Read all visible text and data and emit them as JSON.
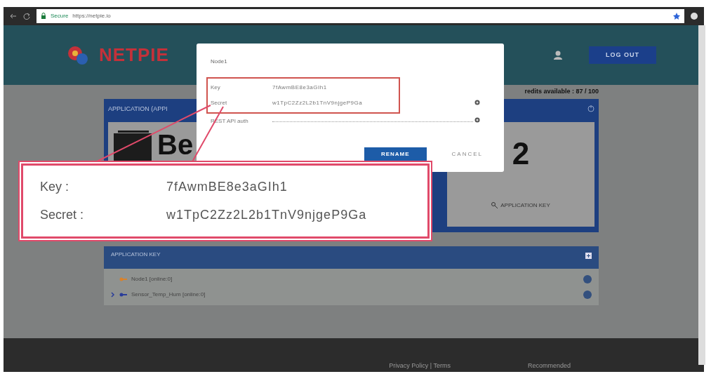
{
  "browser": {
    "secure_label": "Secure",
    "url": "https://netpie.io"
  },
  "header": {
    "logo": "NETPIE",
    "logout": "LOG OUT"
  },
  "credits": "redits available : 87 / 100",
  "app_card": {
    "title": "APPLICATION (APPI",
    "name": "Be",
    "count": "2",
    "key_button": "APPLICATION KEY"
  },
  "key_panel": {
    "title": "APPLICATION KEY",
    "rows": [
      {
        "label": "Node1 [online:0]",
        "kind": "leaf",
        "color": "#d9822b"
      },
      {
        "label": "Sensor_Temp_Hum [online:0]",
        "kind": "group",
        "color": "#2a3d9a"
      }
    ]
  },
  "dialog": {
    "title": "Node1",
    "fields": [
      {
        "label": "Key",
        "value": "7fAwmBE8e3aGIh1",
        "kind": "text",
        "highlighted": true
      },
      {
        "label": "Secret",
        "value": "w1TpC2Zz2L2b1TnV9njgeP9Ga",
        "kind": "reveal",
        "highlighted": true
      },
      {
        "label": "REST API auth",
        "kind": "password",
        "highlighted": false
      }
    ],
    "buttons": [
      {
        "label": "RENAME",
        "kind": "primary"
      },
      {
        "label": "CANCEL",
        "kind": "flat"
      }
    ]
  },
  "callout": {
    "rows": [
      {
        "label": "Key :",
        "value": "7fAwmBE8e3aGIh1"
      },
      {
        "label": "Secret :",
        "value": "w1TpC2Zz2L2b1TnV9njgeP9Ga"
      }
    ]
  },
  "footer": {
    "links": "Privacy Policy | Terms",
    "recommended": "Recommended"
  }
}
